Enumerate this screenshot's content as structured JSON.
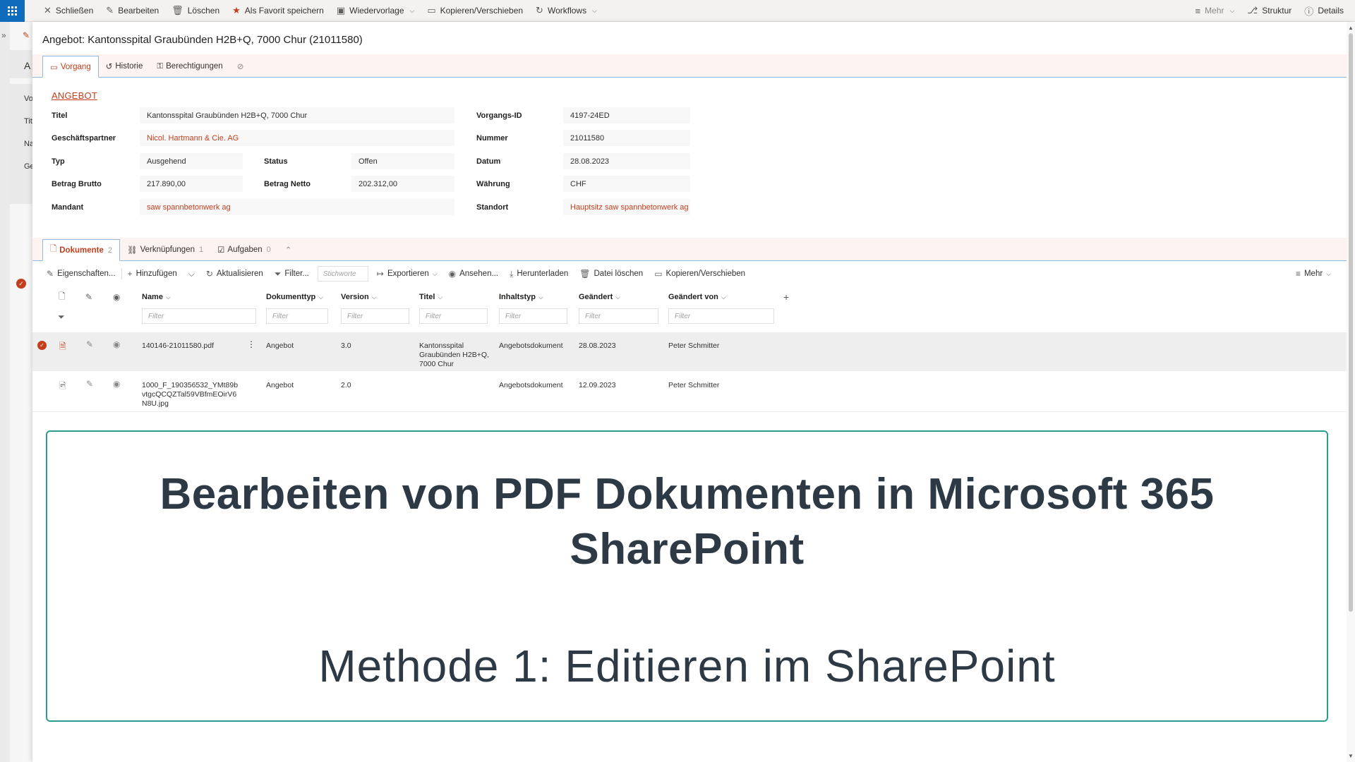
{
  "topbar": {
    "commands": [
      {
        "label": "Schließen"
      },
      {
        "label": "Bearbeiten"
      },
      {
        "label": "Löschen"
      },
      {
        "label": "Als Favorit speichern"
      },
      {
        "label": "Wiedervorlage"
      },
      {
        "label": "Kopieren/Verschieben"
      },
      {
        "label": "Workflows"
      }
    ],
    "right": {
      "more": "Mehr",
      "structure": "Struktur",
      "details": "Details"
    }
  },
  "background_page": {
    "letters": [
      "A",
      "Vo",
      "Tit",
      "Na",
      "Ge"
    ]
  },
  "panel": {
    "title": "Angebot: Kantonsspital Graubünden H2B+Q, 7000 Chur (21011580)",
    "tabs": [
      {
        "label": "Vorgang"
      },
      {
        "label": "Historie"
      },
      {
        "label": "Berechtigungen"
      }
    ],
    "section_title": "ANGEBOT",
    "fields": {
      "titel": {
        "label": "Titel",
        "value": "Kantonsspital Graubünden H2B+Q, 7000 Chur"
      },
      "partner": {
        "label": "Geschäftspartner",
        "value": "Nicol. Hartmann & Cie. AG"
      },
      "typ": {
        "label": "Typ",
        "value": "Ausgehend"
      },
      "status": {
        "label": "Status",
        "value": "Offen"
      },
      "brutto": {
        "label": "Betrag Brutto",
        "value": "217.890,00"
      },
      "netto": {
        "label": "Betrag Netto",
        "value": "202.312,00"
      },
      "mandant": {
        "label": "Mandant",
        "value": "saw spannbetonwerk ag"
      },
      "vorgangs_id": {
        "label": "Vorgangs-ID",
        "value": "4197-24ED"
      },
      "nummer": {
        "label": "Nummer",
        "value": "21011580"
      },
      "datum": {
        "label": "Datum",
        "value": "28.08.2023"
      },
      "waehrung": {
        "label": "Währung",
        "value": "CHF"
      },
      "standort": {
        "label": "Standort",
        "value": "Hauptsitz saw spannbetonwerk ag"
      }
    },
    "doc_tabs": [
      {
        "label": "Dokumente",
        "count": "2"
      },
      {
        "label": "Verknüpfungen",
        "count": "1"
      },
      {
        "label": "Aufgaben",
        "count": "0"
      }
    ],
    "toolbar": {
      "properties": "Eigenschaften...",
      "add": "Hinzufügen",
      "refresh": "Aktualisieren",
      "filter": "Filter...",
      "keywords_placeholder": "Stichworte",
      "export": "Exportieren",
      "view": "Ansehen...",
      "download": "Herunterladen",
      "delete_file": "Datei löschen",
      "copy_move": "Kopieren/Verschieben",
      "more": "Mehr"
    },
    "table": {
      "columns": [
        "Name",
        "Dokumenttyp",
        "Version",
        "Titel",
        "Inhaltstyp",
        "Geändert",
        "Geändert von"
      ],
      "filter_placeholder": "Filter",
      "rows": [
        {
          "name": "140146-21011580.pdf",
          "doctype": "Angebot",
          "version": "3.0",
          "title": "Kantonsspital Graubünden H2B+Q, 7000 Chur",
          "contenttype": "Angebotsdokument",
          "modified": "28.08.2023",
          "modified_by": "Peter Schmitter"
        },
        {
          "name": "1000_F_190356532_YMt89bvtgcQCQZTal59VBfmEOirV6N8U.jpg",
          "doctype": "Angebot",
          "version": "2.0",
          "title": "",
          "contenttype": "Angebotsdokument",
          "modified": "12.09.2023",
          "modified_by": "Peter Schmitter"
        }
      ]
    }
  },
  "banner": {
    "title": "Bearbeiten von PDF Dokumenten in Microsoft 365 SharePoint",
    "subtitle": "Methode 1: Editieren im SharePoint"
  },
  "colors": {
    "accent": "#c43e1c",
    "brand": "#0f6cbd",
    "banner_border": "#2a9d8f"
  }
}
